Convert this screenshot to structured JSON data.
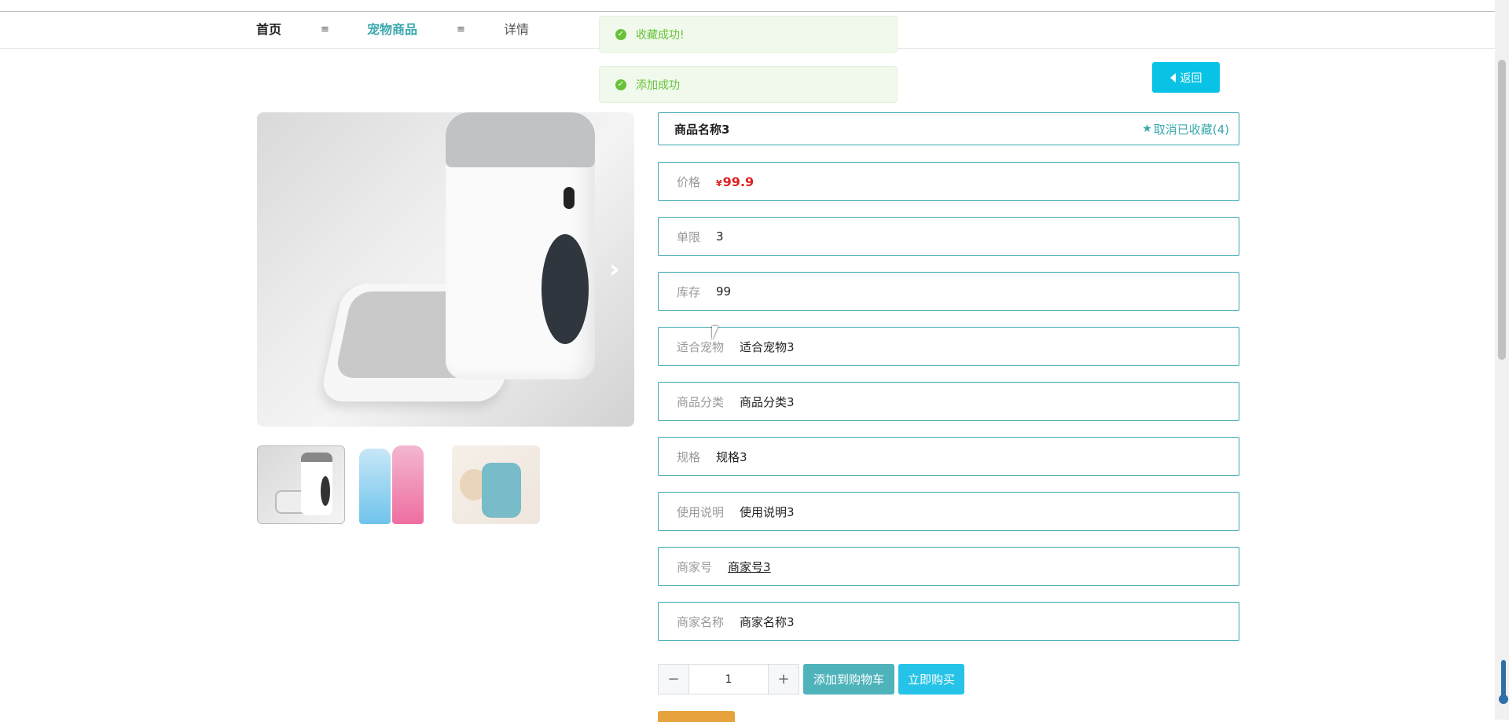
{
  "nav": {
    "home": "首页",
    "sep1": "≡",
    "category": "宠物商品",
    "sep2": "≡",
    "detail": "详情"
  },
  "toasts": [
    {
      "message": "收藏成功!",
      "icon": "check-circle-icon"
    },
    {
      "message": "添加成功",
      "icon": "check-circle-icon"
    }
  ],
  "back_button": {
    "label": "返回",
    "icon": "caret-left-icon"
  },
  "product": {
    "name": "商品名称3",
    "favorite_label": "取消已收藏(4)",
    "favorite_icon": "star-icon",
    "fields": [
      {
        "label": "价格",
        "currency": "¥",
        "value": "99.9"
      },
      {
        "label": "单限",
        "value": "3"
      },
      {
        "label": "库存",
        "value": "99"
      },
      {
        "label": "适合宠物",
        "value": "适合宠物3"
      },
      {
        "label": "商品分类",
        "value": "商品分类3"
      },
      {
        "label": "规格",
        "value": "规格3"
      },
      {
        "label": "使用说明",
        "value": "使用说明3"
      },
      {
        "label": "商家号",
        "value": "商家号3"
      },
      {
        "label": "商家名称",
        "value": "商家名称3"
      }
    ]
  },
  "gallery": {
    "next_icon": "chevron-right-icon",
    "thumbnail_count": 3
  },
  "purchase": {
    "minus": "−",
    "quantity": "1",
    "plus": "+",
    "add_to_cart": "添加到购物车",
    "buy_now": "立即购买"
  },
  "colors": {
    "accent": "#3aa8ae",
    "price": "#e02020",
    "toast_success": "#67c23a",
    "back_button": "#09c3e6"
  }
}
